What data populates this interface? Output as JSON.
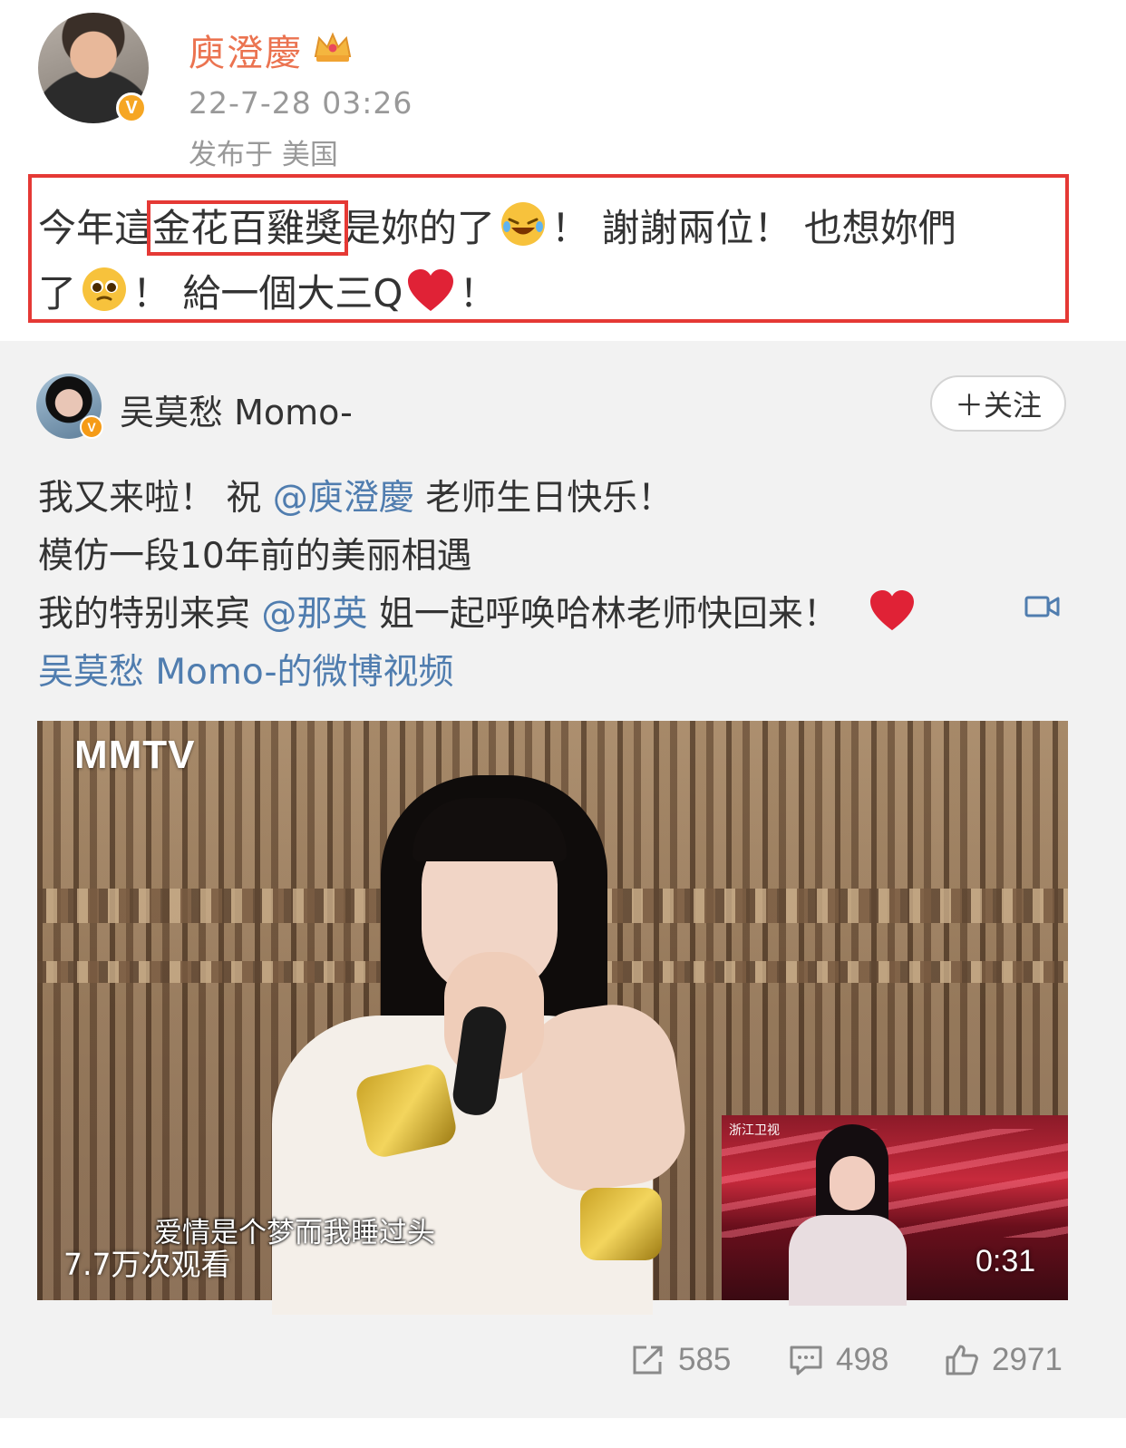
{
  "post": {
    "author": "庾澄慶",
    "time": "22-7-28 03:26",
    "location": "发布于 美国",
    "line1_a": "今年這",
    "line1_highlight": "金花百雞獎",
    "line1_b": "是妳的了",
    "line1_c": "！ 謝謝兩位！ 也想妳們",
    "line2_a": "了",
    "line2_b": "！ 給一個大三Q",
    "line2_c": "！"
  },
  "repost": {
    "author": "吴莫愁 Momo-",
    "follow_label": "＋关注",
    "line1_a": "我又来啦！ 祝 ",
    "line1_mention": "@庾澄慶",
    "line1_b": " 老师生日快乐！",
    "line2": "模仿一段10年前的美丽相遇",
    "line3_a": "我的特别来宾 ",
    "line3_mention": "@那英",
    "line3_b": " 姐一起呼唤哈林老师快回来！",
    "video_link": "吴莫愁 Momo-的微博视频"
  },
  "video": {
    "watermark": "MMTV",
    "subtitle": "爱情是个梦而我睡过头",
    "views": "7.7万次观看",
    "pip_logo": "浙江卫视",
    "duration": "0:31"
  },
  "actions": {
    "shares": "585",
    "comments": "498",
    "likes": "2971"
  },
  "colors": {
    "author_name": "#eb7350",
    "link": "#507daf",
    "highlight_box": "#e53935",
    "verified_badge": "#f6a623"
  },
  "icons": [
    "crown-icon",
    "verified-icon",
    "laughing-emoji-icon",
    "pleading-emoji-icon",
    "heart-icon",
    "video-link-icon",
    "share-icon",
    "comment-icon",
    "like-icon"
  ]
}
